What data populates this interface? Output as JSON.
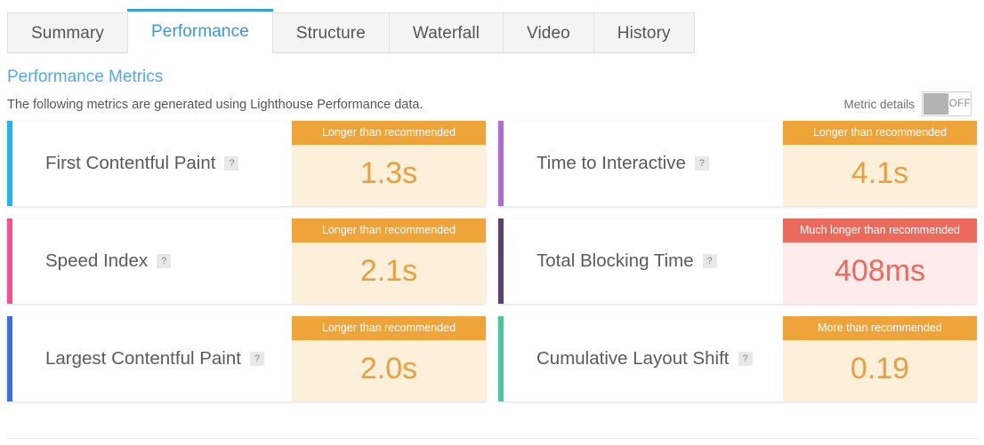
{
  "tabs": [
    {
      "label": "Summary",
      "active": false
    },
    {
      "label": "Performance",
      "active": true
    },
    {
      "label": "Structure",
      "active": false
    },
    {
      "label": "Waterfall",
      "active": false
    },
    {
      "label": "Video",
      "active": false
    },
    {
      "label": "History",
      "active": false
    }
  ],
  "section": {
    "title": "Performance Metrics",
    "description": "The following metrics are generated using Lighthouse Performance data."
  },
  "metric_details": {
    "label": "Metric details",
    "state": "OFF"
  },
  "colors": {
    "accent_blue": "#2f9fe0",
    "title_blue": "#56a8e8",
    "warn_banner": "#efa43a",
    "warn_body": "#fdf0da",
    "warn_text": "#e9a03c",
    "bad_banner": "#ec6a5c",
    "bad_body": "#fdeceb",
    "bad_text": "#ec6a5c"
  },
  "metrics": [
    {
      "name": "First Contentful Paint",
      "help": "?",
      "accent": "#22b3ef",
      "status_label": "Longer than recommended",
      "status": "warn",
      "value": "1.3s"
    },
    {
      "name": "Time to Interactive",
      "help": "?",
      "accent": "#b06ad4",
      "status_label": "Longer than recommended",
      "status": "warn",
      "value": "4.1s"
    },
    {
      "name": "Speed Index",
      "help": "?",
      "accent": "#f4538f",
      "status_label": "Longer than recommended",
      "status": "warn",
      "value": "2.1s"
    },
    {
      "name": "Total Blocking Time",
      "help": "?",
      "accent": "#5e3f6b",
      "status_label": "Much longer than recommended",
      "status": "bad",
      "value": "408ms"
    },
    {
      "name": "Largest Contentful Paint",
      "help": "?",
      "accent": "#3a6fe0",
      "status_label": "Longer than recommended",
      "status": "warn",
      "value": "2.0s"
    },
    {
      "name": "Cumulative Layout Shift",
      "help": "?",
      "accent": "#47c79a",
      "status_label": "More than recommended",
      "status": "warn",
      "value": "0.19"
    }
  ]
}
